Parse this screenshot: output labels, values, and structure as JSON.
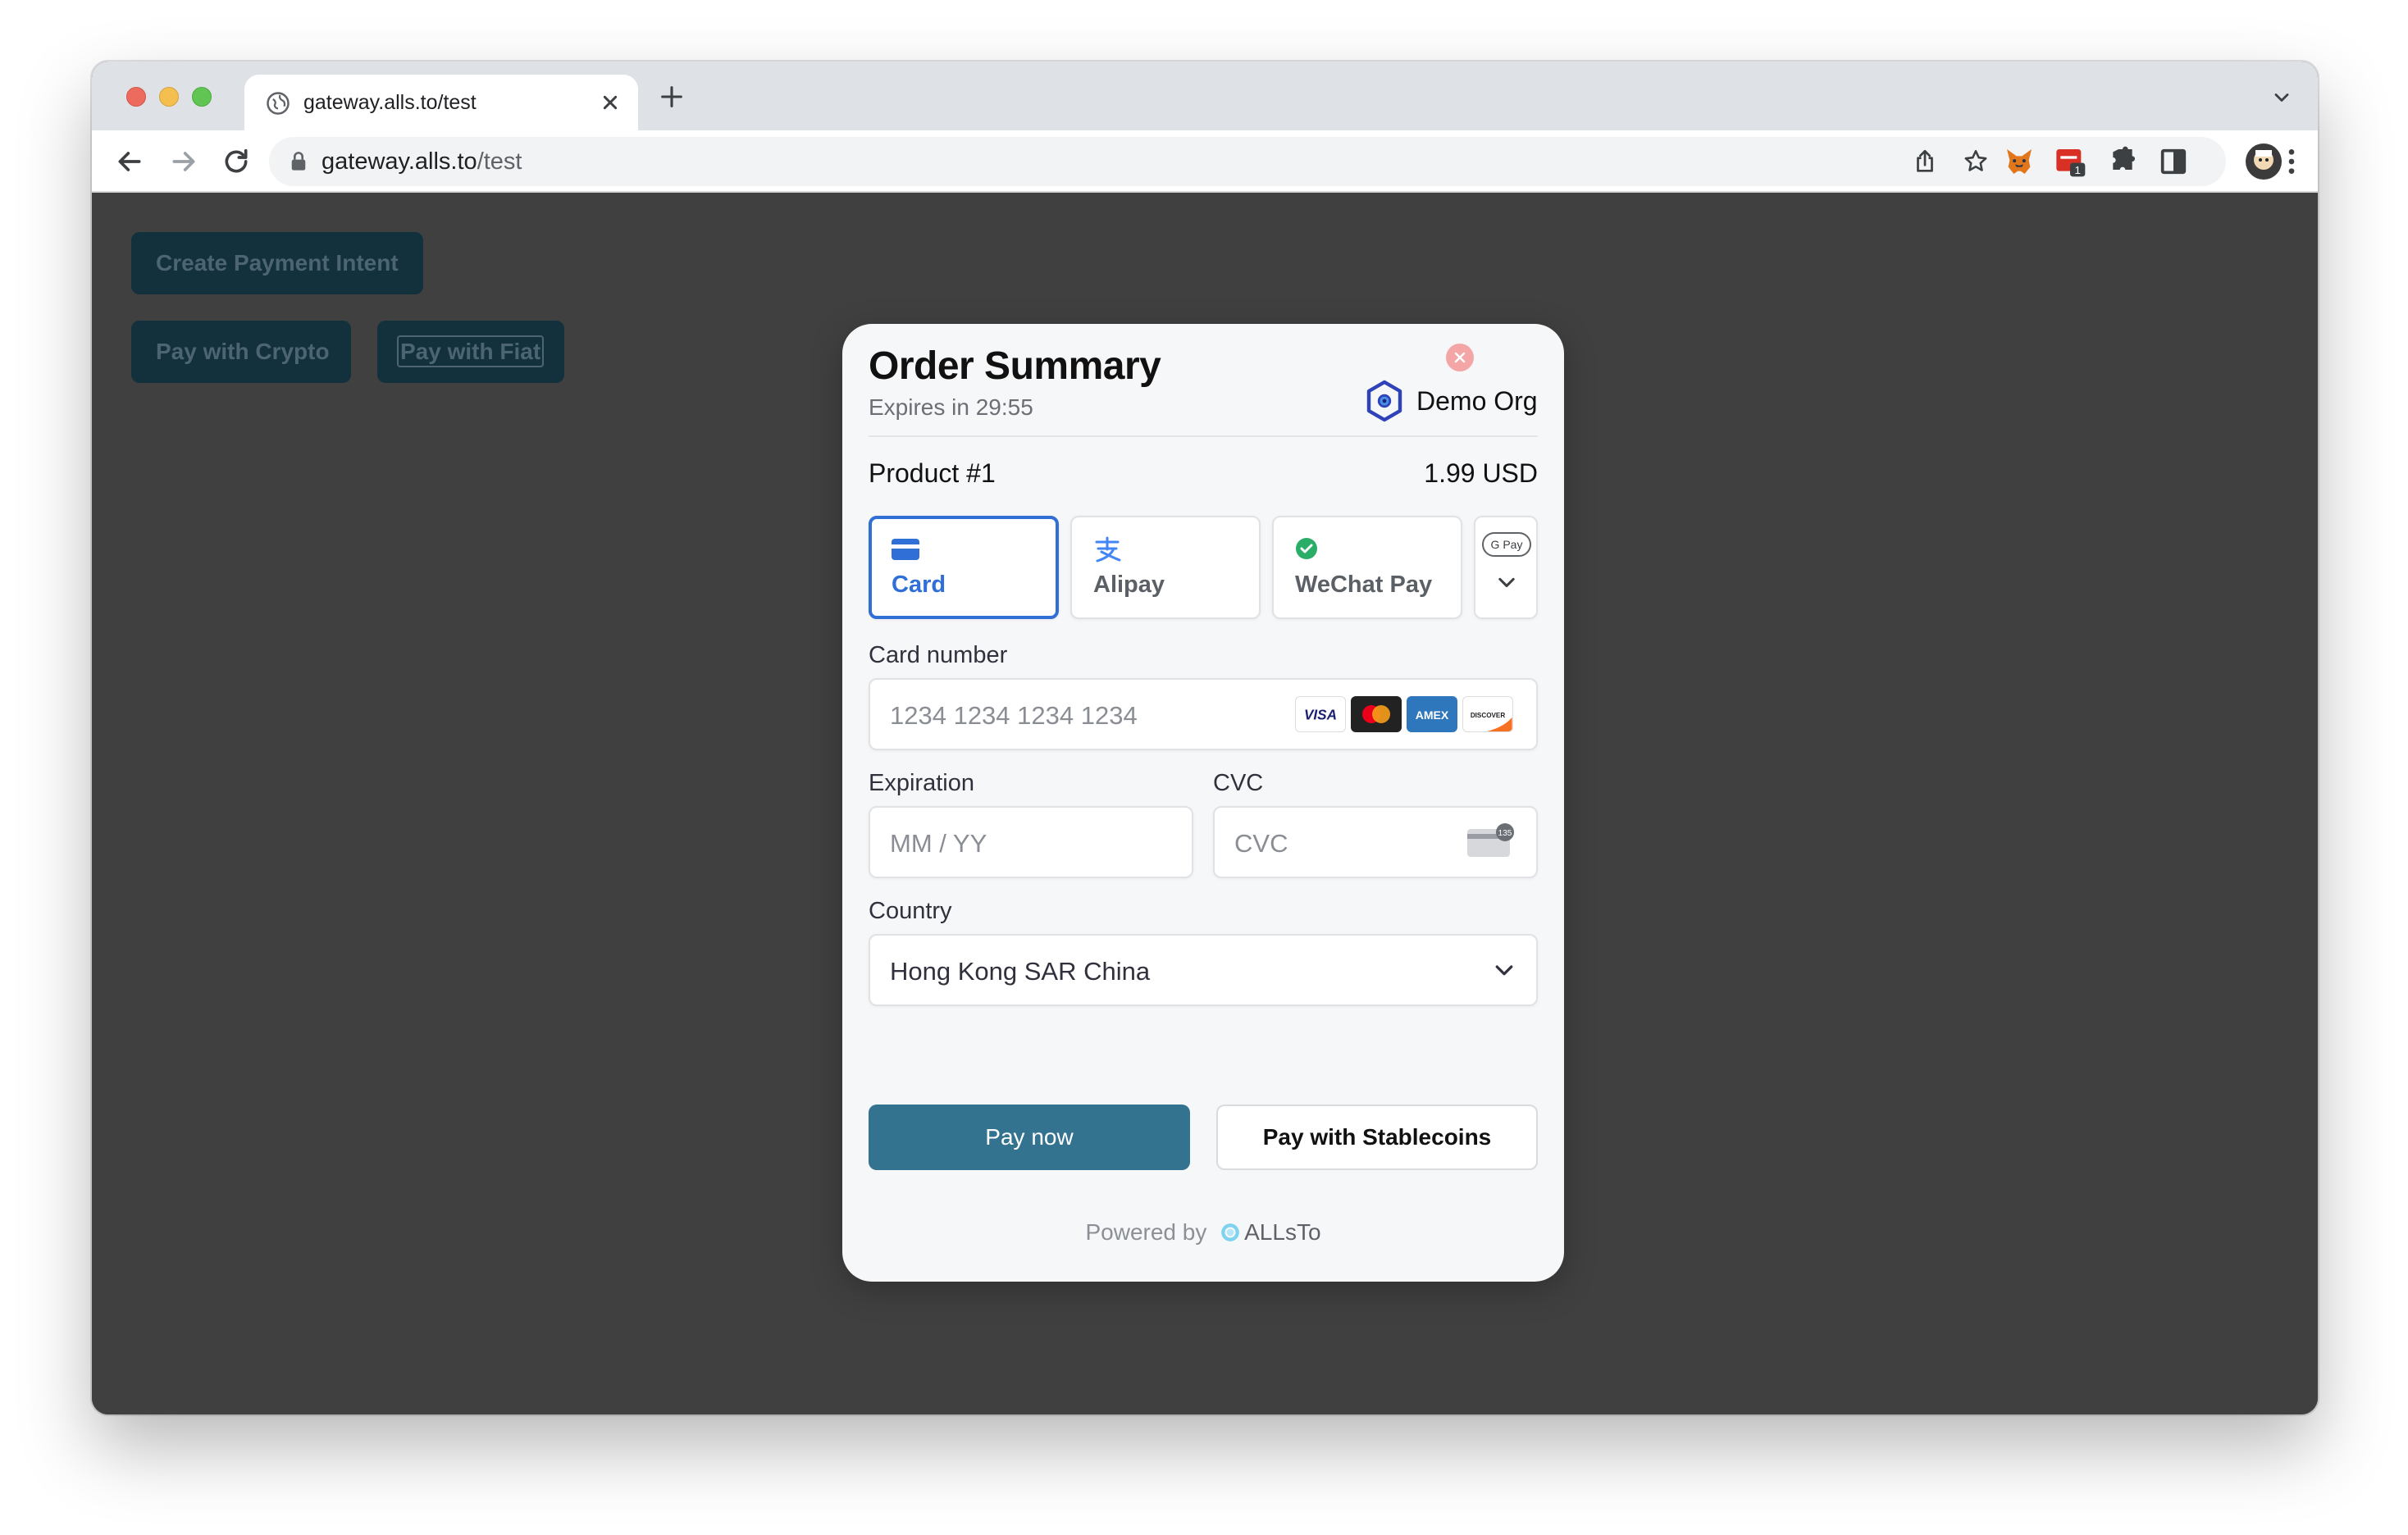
{
  "browser": {
    "tab_title": "gateway.alls.to/test",
    "url_host": "gateway.alls.to",
    "url_path": "/test",
    "extension_badge": "1"
  },
  "page": {
    "create_intent_label": "Create Payment Intent",
    "pay_crypto_label": "Pay with Crypto",
    "pay_fiat_label": "Pay with Fiat"
  },
  "modal": {
    "title": "Order Summary",
    "expires": "Expires in 29:55",
    "org_name": "Demo Org",
    "product_name": "Product #1",
    "product_price": "1.99 USD",
    "methods": [
      {
        "label": "Card",
        "icon": "card-icon",
        "active": true
      },
      {
        "label": "Alipay",
        "icon": "alipay-icon",
        "active": false
      },
      {
        "label": "WeChat Pay",
        "icon": "wechat-icon",
        "active": false
      },
      {
        "label": "G Pay",
        "icon": "gpay-icon",
        "active": false
      }
    ],
    "card_number_label": "Card number",
    "card_number_placeholder": "1234 1234 1234 1234",
    "card_brands": [
      "VISA",
      "Mastercard",
      "AMEX",
      "DISCOVER"
    ],
    "expiration_label": "Expiration",
    "expiration_placeholder": "MM / YY",
    "cvc_label": "CVC",
    "cvc_placeholder": "CVC",
    "cvc_icon_text": "135",
    "country_label": "Country",
    "country_value": "Hong Kong SAR China",
    "pay_now_label": "Pay now",
    "pay_stablecoins_label": "Pay with Stablecoins",
    "powered_by": "Powered by",
    "powered_brand": "ALLsTo"
  },
  "colors": {
    "accent": "#2f6fd6",
    "pay_button": "#347390",
    "page_background": "#404040",
    "page_button": "#13303d"
  }
}
